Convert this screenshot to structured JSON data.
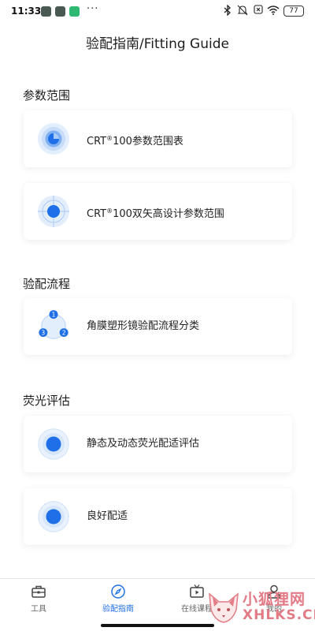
{
  "status_bar": {
    "time": "11:33",
    "more": "···",
    "battery": "77",
    "icons": [
      "app-notification-icon",
      "app-notification-icon",
      "app-notification-icon",
      "bluetooth-icon",
      "mute-icon",
      "sim-icon",
      "wifi-icon",
      "battery-icon"
    ]
  },
  "header": {
    "title": "验配指南/Fitting Guide"
  },
  "sections": [
    {
      "title": "参数范围",
      "items": [
        {
          "prefix": "CRT",
          "sup": "®",
          "suffix": "100参数范围表",
          "icon": "concentric-circle-icon"
        },
        {
          "prefix": "CRT",
          "sup": "®",
          "suffix": "100双矢高设计参数范围",
          "icon": "crosshair-circle-icon"
        }
      ]
    },
    {
      "title": "验配流程",
      "items": [
        {
          "label": "角膜塑形镜验配流程分类",
          "icon": "process-cycle-icon",
          "steps": [
            "1",
            "2",
            "3"
          ]
        }
      ]
    },
    {
      "title": "荧光评估",
      "items": [
        {
          "label": "静态及动态荧光配适评估",
          "icon": "fluorescein-icon"
        },
        {
          "label": "良好配适",
          "icon": "fluorescein-icon"
        }
      ]
    }
  ],
  "bottom_nav": {
    "items": [
      {
        "label": "工具",
        "icon": "toolbox-icon",
        "active": false
      },
      {
        "label": "验配指南",
        "icon": "compass-icon",
        "active": true
      },
      {
        "label": "在线课程",
        "icon": "tv-play-icon",
        "active": false
      },
      {
        "label": "我的",
        "icon": "person-icon",
        "active": false
      }
    ]
  },
  "watermark": {
    "title": "小狐狸网",
    "subtitle": "XHLKS.CN"
  },
  "colors": {
    "accent": "#1f6fe8",
    "icon_light": "#d6e6fb",
    "text": "#222222",
    "watermark": "#e37b86"
  }
}
